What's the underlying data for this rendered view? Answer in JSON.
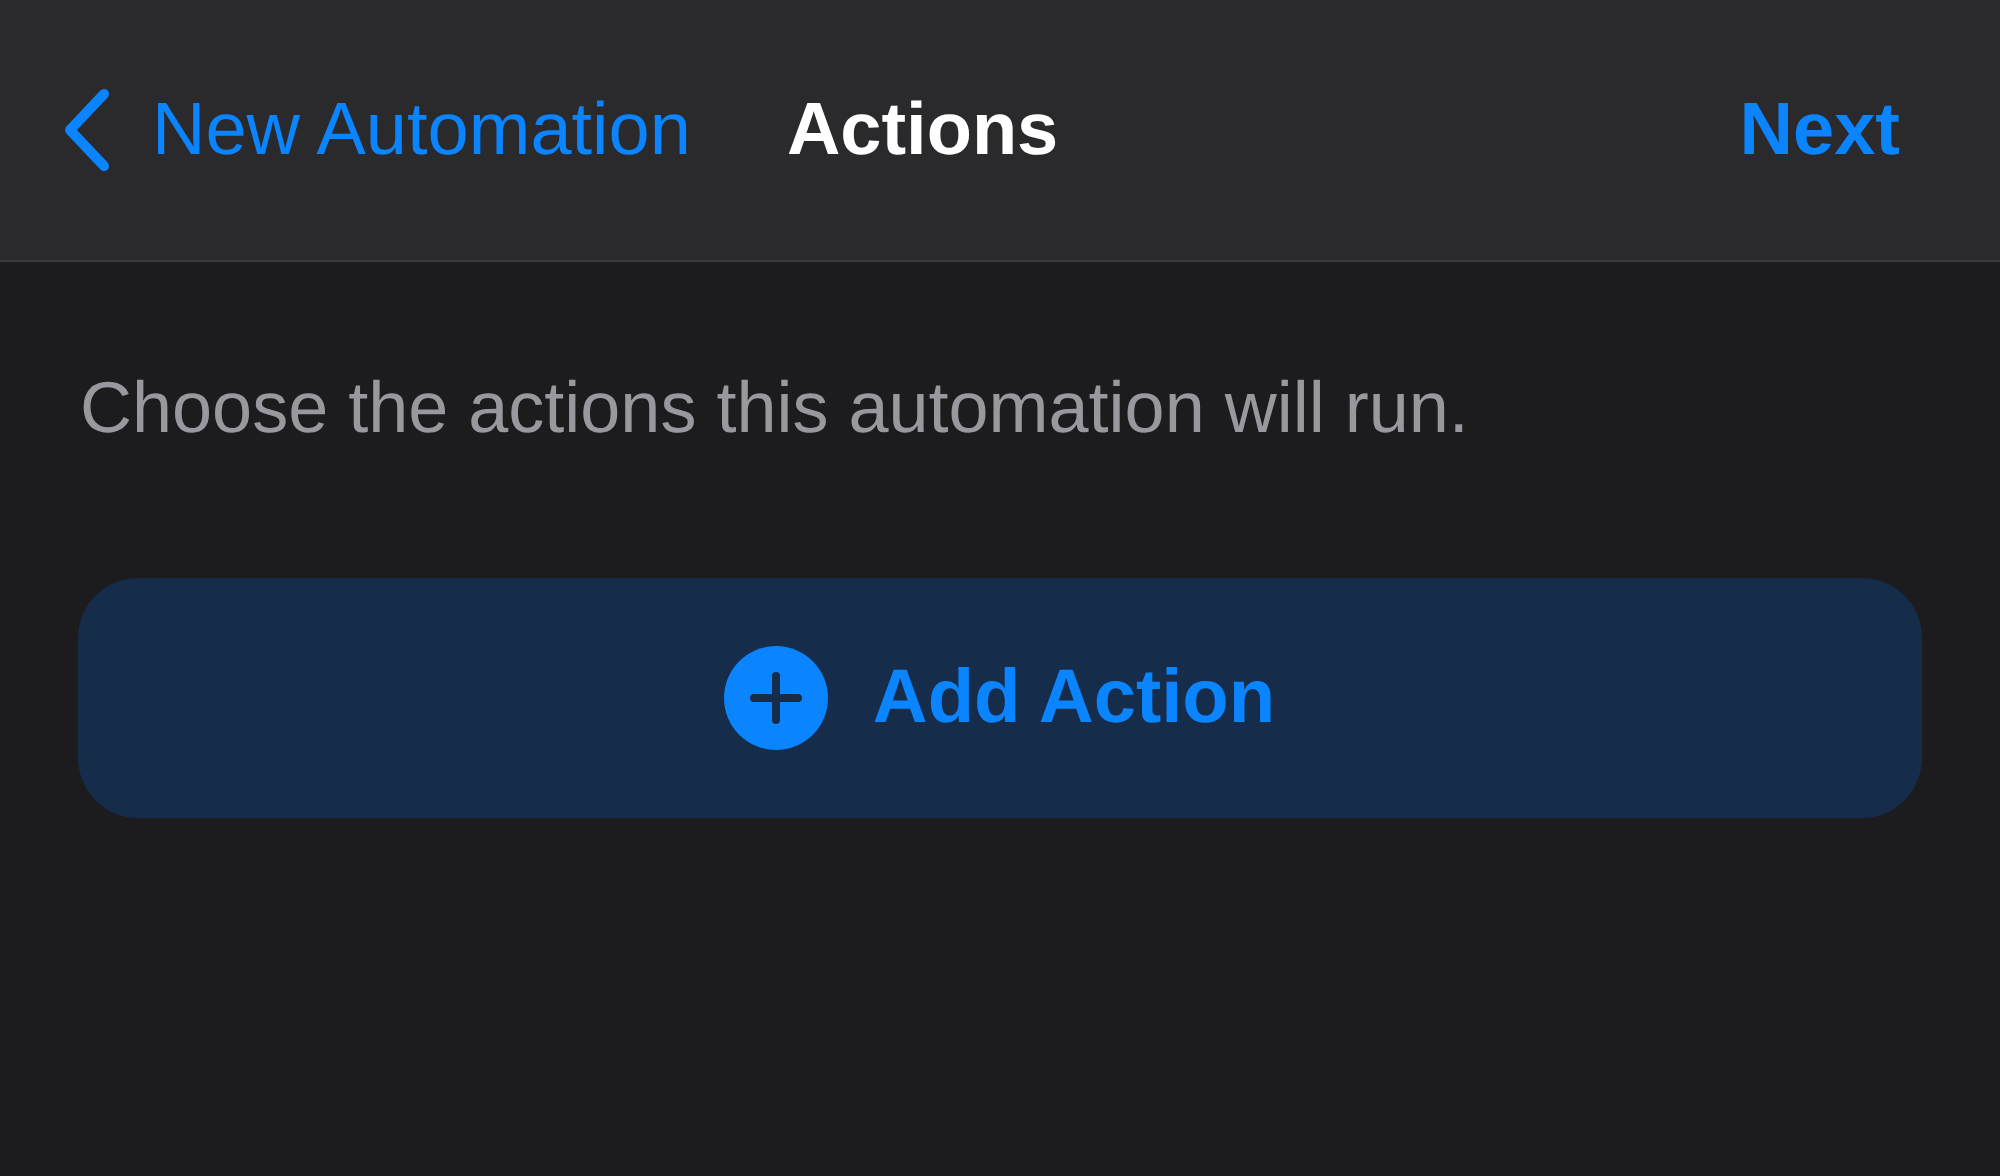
{
  "nav_bar": {
    "back_label": "New Automation",
    "title": "Actions",
    "next_label": "Next"
  },
  "description": "Choose the actions this automation will run.",
  "add_button": {
    "label": "Add Action"
  }
}
